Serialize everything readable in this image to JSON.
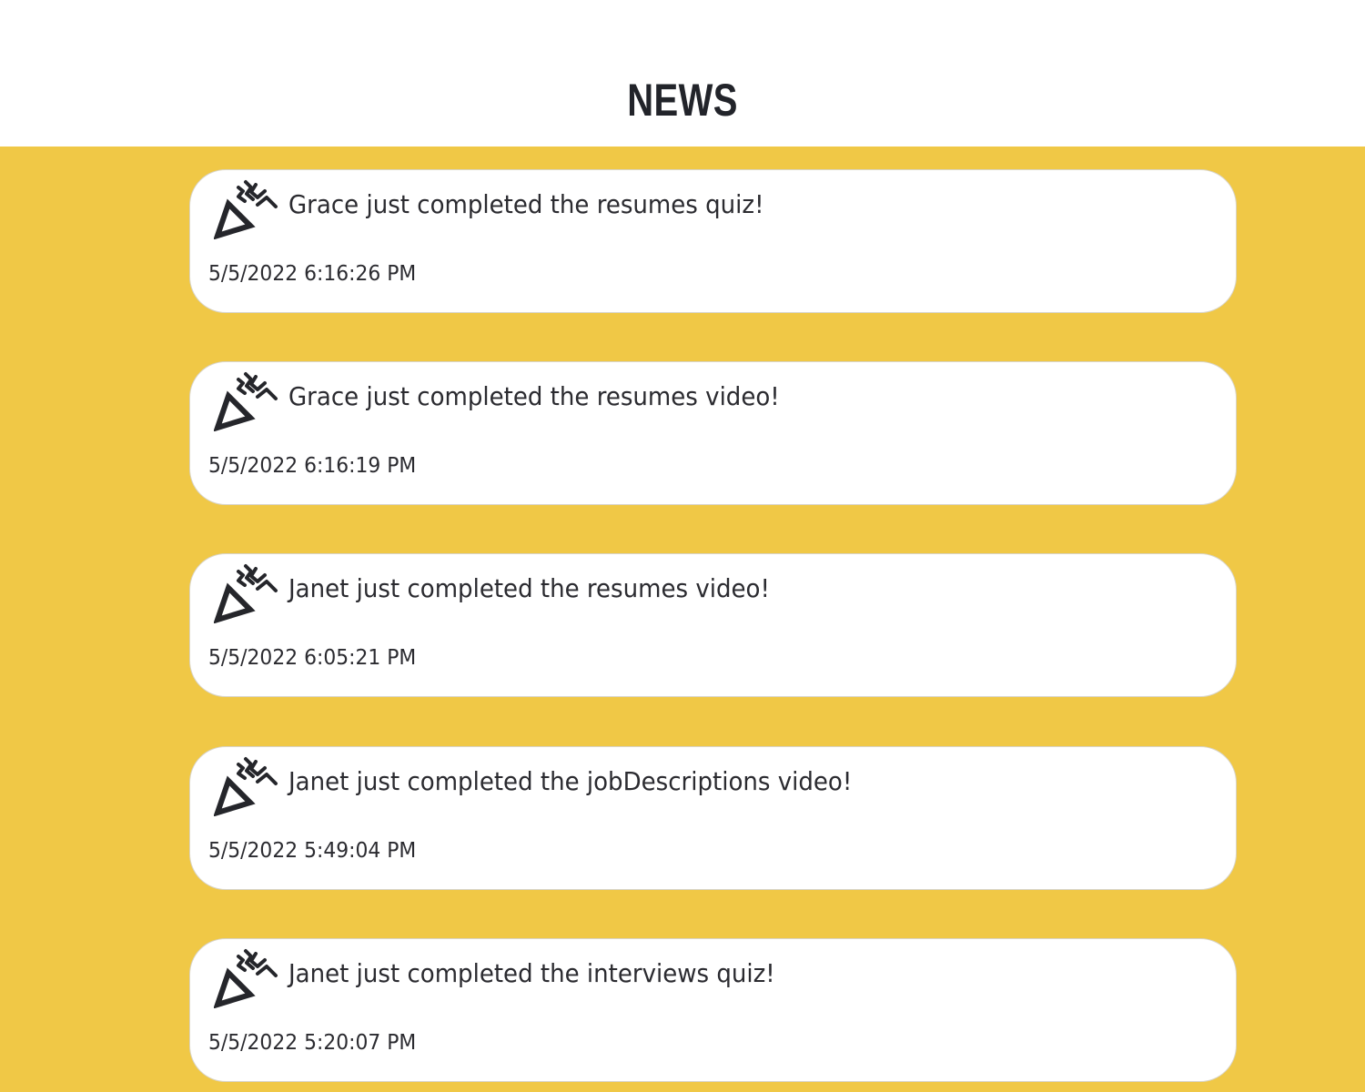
{
  "page": {
    "title": "NEWS"
  },
  "colors": {
    "feed_background": "#f0c846",
    "card_background": "#ffffff",
    "text": "#2b2b30"
  },
  "feed": {
    "items": [
      {
        "icon": "party-popper-icon",
        "message": "Grace just completed the resumes quiz!",
        "timestamp": "5/5/2022 6:16:26 PM"
      },
      {
        "icon": "party-popper-icon",
        "message": "Grace just completed the resumes video!",
        "timestamp": "5/5/2022 6:16:19 PM"
      },
      {
        "icon": "party-popper-icon",
        "message": "Janet just completed the resumes video!",
        "timestamp": "5/5/2022 6:05:21 PM"
      },
      {
        "icon": "party-popper-icon",
        "message": "Janet just completed the jobDescriptions video!",
        "timestamp": "5/5/2022 5:49:04 PM"
      },
      {
        "icon": "party-popper-icon",
        "message": "Janet just completed the interviews quiz!",
        "timestamp": "5/5/2022 5:20:07 PM"
      }
    ]
  }
}
